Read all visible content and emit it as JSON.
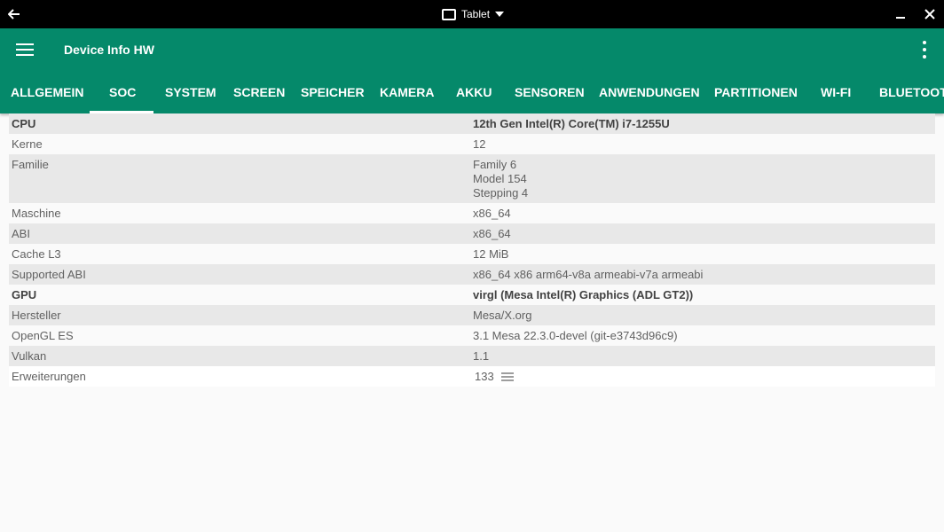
{
  "titlebar": {
    "mode_label": "Tablet"
  },
  "appbar": {
    "title": "Device Info HW",
    "tabs": [
      "ALLGEMEIN",
      "SOC",
      "SYSTEM",
      "SCREEN",
      "SPEICHER",
      "KAMERA",
      "AKKU",
      "SENSOREN",
      "ANWENDUNGEN",
      "PARTITIONEN",
      "WI-FI",
      "BLUETOOTH"
    ],
    "selected_tab": "SOC",
    "accent_color": "#05896a"
  },
  "soc": {
    "rows": [
      {
        "label": "CPU",
        "value": "12th Gen Intel(R) Core(TM) i7-1255U"
      },
      {
        "label": "Kerne",
        "value": "12"
      },
      {
        "label": "Familie",
        "value_lines": [
          "Family 6",
          "Model 154",
          "Stepping 4"
        ]
      },
      {
        "label": "Maschine",
        "value": "x86_64"
      },
      {
        "label": "ABI",
        "value": "x86_64"
      },
      {
        "label": "Cache L3",
        "value": "12 MiB"
      },
      {
        "label": "Supported ABI",
        "value": "x86_64 x86 arm64-v8a armeabi-v7a armeabi"
      },
      {
        "label": "GPU",
        "value": "virgl (Mesa Intel(R) Graphics (ADL GT2))"
      },
      {
        "label": "Hersteller",
        "value": "Mesa/X.org"
      },
      {
        "label": "OpenGL ES",
        "value": "3.1 Mesa 22.3.0-devel (git-e3743d96c9)"
      },
      {
        "label": "Vulkan",
        "value": "1.1"
      },
      {
        "label": "Erweiterungen",
        "value": "133"
      }
    ]
  }
}
